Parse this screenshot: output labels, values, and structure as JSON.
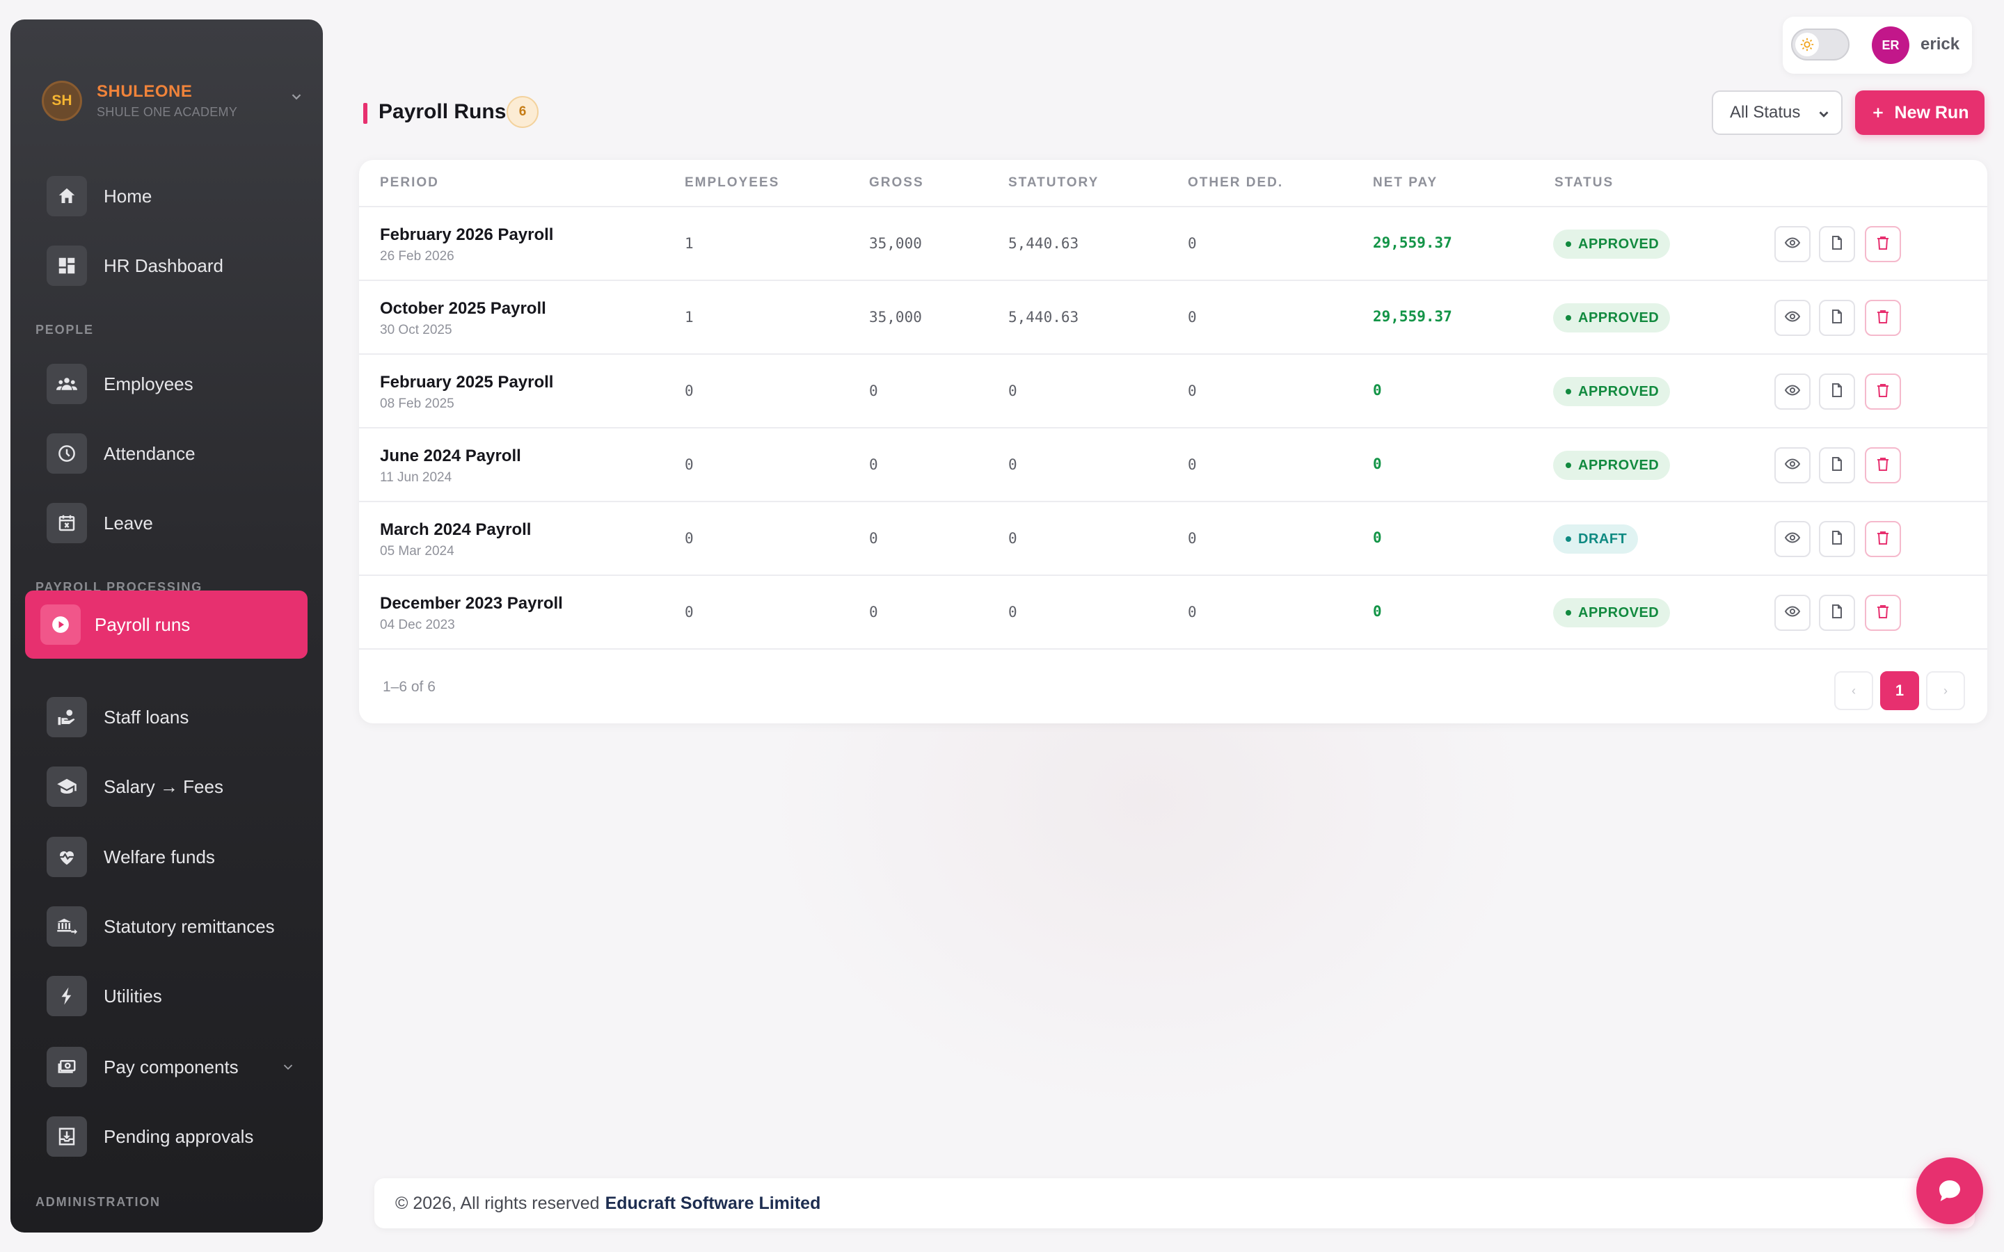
{
  "org": {
    "initials": "SH",
    "name": "SHULEONE",
    "subtitle": "SHULE ONE ACADEMY"
  },
  "sidebar": {
    "items": [
      {
        "label": "Home",
        "icon": "home-icon"
      },
      {
        "label": "HR Dashboard",
        "icon": "dashboard-icon"
      },
      {
        "label": "Employees",
        "icon": "people-icon"
      },
      {
        "label": "Attendance",
        "icon": "clock-icon"
      },
      {
        "label": "Leave",
        "icon": "calendar-x-icon"
      },
      {
        "label": "Payroll runs",
        "icon": "play-circle-icon",
        "active": true
      },
      {
        "label": "Staff loans",
        "icon": "hand-coin-icon"
      },
      {
        "label": "Salary → Fees",
        "icon": "graduation-cap-icon"
      },
      {
        "label": "Welfare funds",
        "icon": "heart-pulse-icon"
      },
      {
        "label": "Statutory remittances",
        "icon": "bank-transfer-icon"
      },
      {
        "label": "Utilities",
        "icon": "bolt-icon"
      },
      {
        "label": "Pay components",
        "icon": "cash-icon"
      },
      {
        "label": "Pending approvals",
        "icon": "inbox-download-icon"
      }
    ],
    "sections": {
      "people": "PEOPLE",
      "payroll": "PAYROLL PROCESSING",
      "admin": "ADMINISTRATION"
    }
  },
  "user": {
    "initials": "ER",
    "name": "erick"
  },
  "header": {
    "title": "Payroll Runs",
    "count": "6",
    "filter_value": "All Status",
    "new_button": "New Run",
    "new_button_icon": "plus-icon"
  },
  "table": {
    "columns": [
      "PERIOD",
      "EMPLOYEES",
      "GROSS",
      "STATUTORY",
      "OTHER DED.",
      "NET PAY",
      "STATUS"
    ],
    "rows": [
      {
        "period": "February 2026 Payroll",
        "date": "26 Feb 2026",
        "employees": "1",
        "gross": "35,000",
        "statutory": "5,440.63",
        "other": "0",
        "net": "29,559.37",
        "status": "APPROVED"
      },
      {
        "period": "October 2025 Payroll",
        "date": "30 Oct 2025",
        "employees": "1",
        "gross": "35,000",
        "statutory": "5,440.63",
        "other": "0",
        "net": "29,559.37",
        "status": "APPROVED"
      },
      {
        "period": "February 2025 Payroll",
        "date": "08 Feb 2025",
        "employees": "0",
        "gross": "0",
        "statutory": "0",
        "other": "0",
        "net": "0",
        "status": "APPROVED"
      },
      {
        "period": "June 2024 Payroll",
        "date": "11 Jun 2024",
        "employees": "0",
        "gross": "0",
        "statutory": "0",
        "other": "0",
        "net": "0",
        "status": "APPROVED"
      },
      {
        "period": "March 2024 Payroll",
        "date": "05 Mar 2024",
        "employees": "0",
        "gross": "0",
        "statutory": "0",
        "other": "0",
        "net": "0",
        "status": "DRAFT"
      },
      {
        "period": "December 2023 Payroll",
        "date": "04 Dec 2023",
        "employees": "0",
        "gross": "0",
        "statutory": "0",
        "other": "0",
        "net": "0",
        "status": "APPROVED"
      }
    ],
    "range": "1–6 of 6",
    "pagination": {
      "prev": "‹",
      "current": "1",
      "next": "›"
    }
  },
  "footer": {
    "text": "© 2026, All rights reserved",
    "company": "Educraft Software Limited"
  },
  "colors": {
    "accent": "#e7306f",
    "approved": "#128a3f",
    "draft": "#0f8a82",
    "net_pay": "#139447"
  }
}
